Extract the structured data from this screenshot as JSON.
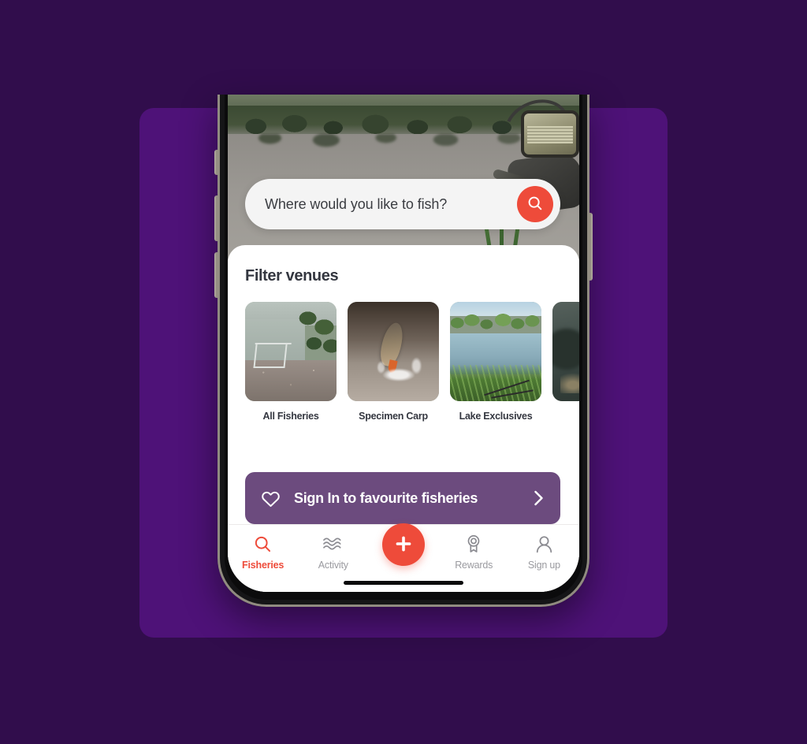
{
  "theme": {
    "page_background": "#310D4C",
    "panel_background": "#4E1278",
    "accent_red": "#EE4B3A",
    "signin_purple": "#6C4B7E",
    "text_dark": "#343740",
    "text_muted": "#9A9A9F"
  },
  "search": {
    "placeholder": "Where would you like to fish?",
    "value": "",
    "button_icon": "search-icon"
  },
  "sheet": {
    "title": "Filter venues",
    "filters": [
      {
        "label": "All Fisheries",
        "image": "lake-with-landing-net-photo"
      },
      {
        "label": "Specimen Carp",
        "image": "carp-jumping-out-of-water-photo"
      },
      {
        "label": "Lake Exclusives",
        "image": "lake-with-rods-photo"
      },
      {
        "label": "",
        "image": "dark-venue-photo-partial"
      }
    ]
  },
  "signin": {
    "label": "Sign In to favourite fisheries",
    "left_icon": "heart-icon",
    "right_icon": "chevron-right-icon"
  },
  "navbar": {
    "items": [
      {
        "label": "Fisheries",
        "icon": "search-icon",
        "active": true
      },
      {
        "label": "Activity",
        "icon": "waves-icon",
        "active": false
      },
      {
        "label": "",
        "icon": "plus-icon",
        "active": false
      },
      {
        "label": "Rewards",
        "icon": "medal-icon",
        "active": false
      },
      {
        "label": "Sign up",
        "icon": "person-icon",
        "active": false
      }
    ]
  },
  "hero": {
    "image": "lake-with-fishing-reel-photo"
  }
}
